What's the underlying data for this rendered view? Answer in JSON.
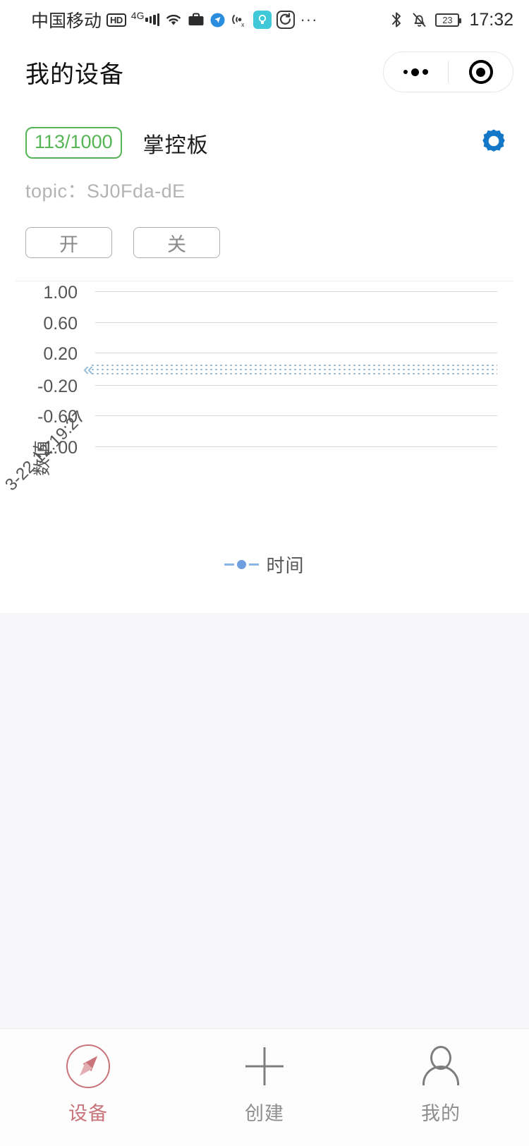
{
  "status_bar": {
    "carrier": "中国移动",
    "hd_label": "HD",
    "network": "4G",
    "signal_icon": "signal-bars-icon",
    "wifi_icon": "wifi-icon",
    "briefcase_icon": "briefcase-icon",
    "compass_blue_icon": "navigation-blue-icon",
    "location_off_icon": "location-off-icon",
    "brightness_icon": "brightness-icon",
    "rotate_icon": "screen-rotate-icon",
    "more_icon": "more-dots-icon",
    "bluetooth_icon": "bluetooth-icon",
    "mute_bell_icon": "bell-muted-icon",
    "battery_level": "23",
    "time": "17:32"
  },
  "nav": {
    "title": "我的设备",
    "capsule_more_icon": "more-dots-icon",
    "capsule_target_icon": "target-circle-icon"
  },
  "device": {
    "quota_badge": "113/1000",
    "name": "掌控板",
    "settings_icon": "gear-icon",
    "topic_label": "topic：SJ0Fda-dE",
    "buttons": [
      {
        "label": "开",
        "name": "device-on-button"
      },
      {
        "label": "关",
        "name": "device-off-button"
      }
    ],
    "badge_color": "#55b555",
    "gear_color": "#1478c8"
  },
  "chart_data": {
    "type": "line",
    "title": "",
    "xlabel": "时间",
    "ylabel": "数值",
    "x": [
      "3-22 12:19:27"
    ],
    "xtick_labels": [
      "3-22 12:19:27"
    ],
    "ytick_labels": [
      "1.00",
      "0.60",
      "0.20",
      "-0.20",
      "-0.60",
      "-1.00"
    ],
    "ylim": [
      -1.0,
      1.0
    ],
    "grid": true,
    "legend_position": "bottom",
    "legend": [
      "时间"
    ],
    "series": [
      {
        "name": "时间",
        "values": [
          0.0
        ],
        "color": "#7ba7c7",
        "style": "dotted"
      }
    ]
  },
  "chart_legend": {
    "label": "时间",
    "marker_icon": "line-dot-marker-icon"
  },
  "tabbar": {
    "items": [
      {
        "label": "设备",
        "icon": "compass-icon",
        "active": true
      },
      {
        "label": "创建",
        "icon": "plus-icon",
        "active": false
      },
      {
        "label": "我的",
        "icon": "person-icon",
        "active": false
      }
    ],
    "active_color": "#c9737a",
    "inactive_color": "#8e8e8e"
  }
}
